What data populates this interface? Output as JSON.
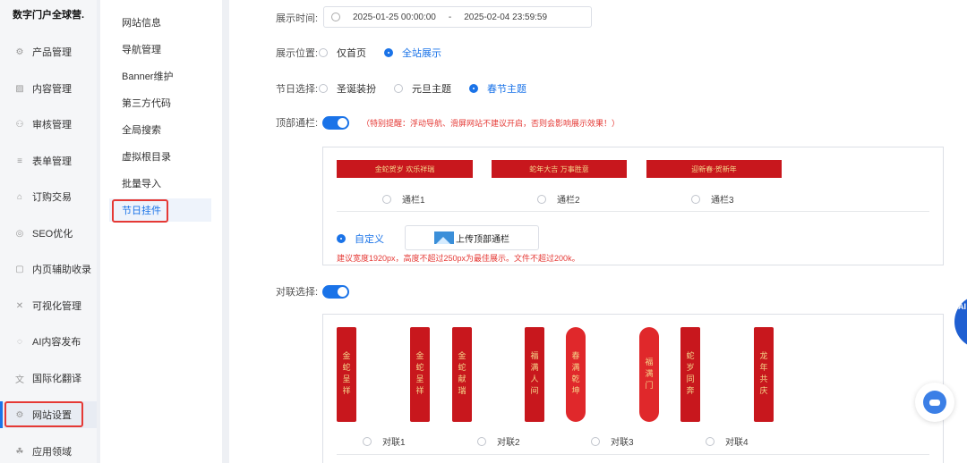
{
  "brand": "数字门户全球营.",
  "sidebar": {
    "items": [
      {
        "label": "产品管理",
        "icon": "product-icon"
      },
      {
        "label": "内容管理",
        "icon": "content-icon"
      },
      {
        "label": "审核管理",
        "icon": "user-icon"
      },
      {
        "label": "表单管理",
        "icon": "list-icon"
      },
      {
        "label": "订购交易",
        "icon": "shop-icon"
      },
      {
        "label": "SEO优化",
        "icon": "seo-icon"
      },
      {
        "label": "内页辅助收录",
        "icon": "page-icon"
      },
      {
        "label": "可视化管理",
        "icon": "visual-icon"
      },
      {
        "label": "AI内容发布",
        "icon": "ai-icon"
      },
      {
        "label": "国际化翻译",
        "icon": "translate-icon"
      },
      {
        "label": "网站设置",
        "icon": "settings-icon"
      },
      {
        "label": "应用领域",
        "icon": "apps-icon"
      }
    ]
  },
  "subnav": {
    "items": [
      {
        "label": "网站信息"
      },
      {
        "label": "导航管理"
      },
      {
        "label": "Banner维护"
      },
      {
        "label": "第三方代码"
      },
      {
        "label": "全局搜索"
      },
      {
        "label": "虚拟根目录"
      },
      {
        "label": "批量导入"
      },
      {
        "label": "节日挂件"
      }
    ]
  },
  "form": {
    "display_time": {
      "label": "展示时间:",
      "start": "2025-01-25 00:00:00",
      "separator": "-",
      "end": "2025-02-04 23:59:59"
    },
    "display_position": {
      "label": "展示位置:",
      "options": [
        "仅首页",
        "全站展示"
      ],
      "selected": "全站展示"
    },
    "holiday": {
      "label": "节日选择:",
      "options": [
        "圣诞装扮",
        "元旦主题",
        "春节主题"
      ],
      "selected": "春节主题"
    },
    "top_banner": {
      "label": "顶部通栏:",
      "enabled": true,
      "warning": "（特别提醒：浮动导航、滑屏网站不建议开启，否则会影响展示效果！）",
      "options": [
        {
          "label": "通栏1",
          "art": "金蛇贺岁  欢乐祥瑞"
        },
        {
          "label": "通栏2",
          "art": "蛇年大吉 万事胜意"
        },
        {
          "label": "通栏3",
          "art": "迎新春·贺新年"
        }
      ],
      "custom_label": "自定义",
      "upload_label": "上传顶部通栏",
      "hint": "建议宽度1920px，高度不超过250px为最佳展示。文件不超过200k。"
    },
    "couplet": {
      "label": "对联选择:",
      "enabled": true,
      "options": [
        {
          "label": "对联1",
          "left": "金蛇呈祥",
          "right": "金蛇呈祥"
        },
        {
          "label": "对联2",
          "left": "金蛇献瑞",
          "right": "福满人间"
        },
        {
          "label": "对联3",
          "left": "春满乾坤",
          "right": "福满门"
        },
        {
          "label": "对联4",
          "left": "蛇岁同奔",
          "right": "龙年共庆"
        }
      ]
    }
  },
  "colors": {
    "accent": "#1a73e8",
    "festive_red": "#c8171d",
    "gold": "#f5d58a",
    "warning": "#e53935"
  }
}
